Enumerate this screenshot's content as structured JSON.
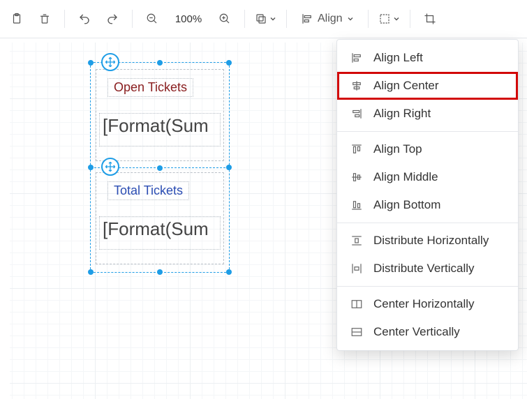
{
  "toolbar": {
    "zoom": "100%",
    "align_label": "Align"
  },
  "canvas": {
    "card1": {
      "title": "Open Tickets",
      "value": "[Format(Sum"
    },
    "card2": {
      "title": "Total Tickets",
      "value": "[Format(Sum"
    }
  },
  "menu": {
    "items": [
      "Align Left",
      "Align Center",
      "Align Right",
      "Align Top",
      "Align Middle",
      "Align Bottom",
      "Distribute Horizontally",
      "Distribute Vertically",
      "Center Horizontally",
      "Center Vertically"
    ]
  }
}
